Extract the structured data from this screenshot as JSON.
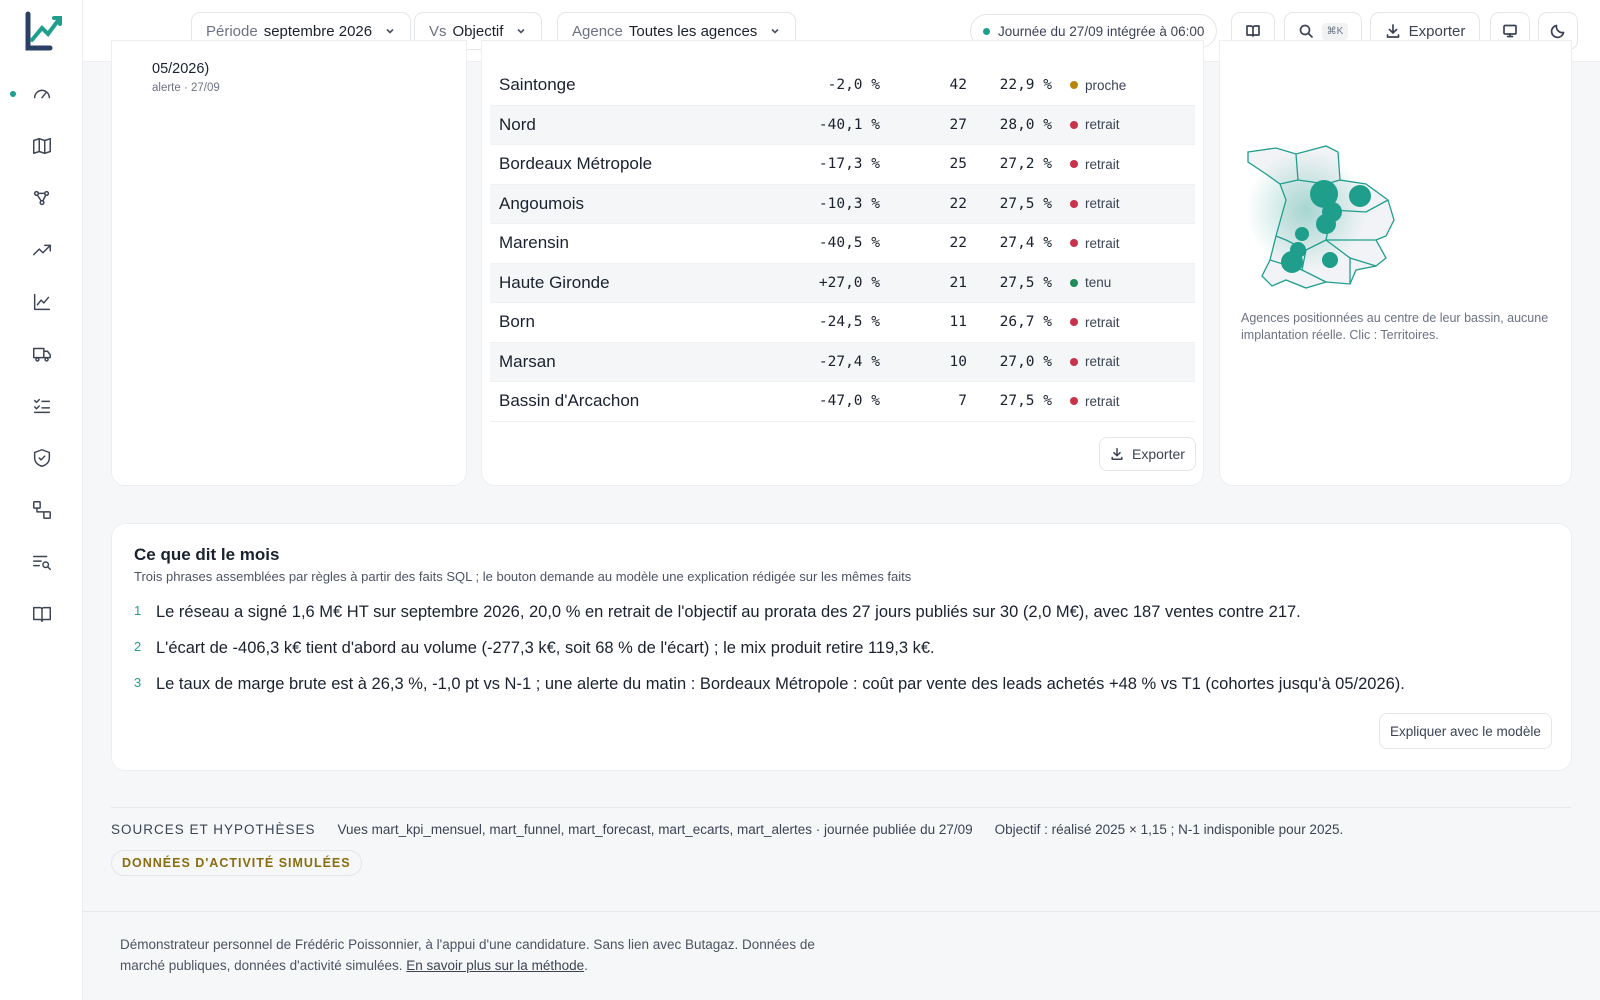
{
  "topbar": {
    "period_label": "Période",
    "period_value": "septembre 2026",
    "vs_label": "Vs",
    "vs_value": "Objectif",
    "agency_label": "Agence",
    "agency_value": "Toutes les agences",
    "status_text": "Journée du 27/09 intégrée à 06:00",
    "search_shortcut": "⌘K",
    "export_label": "Exporter"
  },
  "alert_card": {
    "text_tail": "05/2026)",
    "meta": "alerte · 27/09"
  },
  "agencies_table": {
    "rows": [
      {
        "name": "Saintonge",
        "ecart": "-2,0 %",
        "ventes": "42",
        "marge": "22,9 %",
        "status": "proche",
        "status_color": "#b8860b"
      },
      {
        "name": "Nord",
        "ecart": "-40,1 %",
        "ventes": "27",
        "marge": "28,0 %",
        "status": "retrait",
        "status_color": "#c8324b"
      },
      {
        "name": "Bordeaux Métropole",
        "ecart": "-17,3 %",
        "ventes": "25",
        "marge": "27,2 %",
        "status": "retrait",
        "status_color": "#c8324b"
      },
      {
        "name": "Angoumois",
        "ecart": "-10,3 %",
        "ventes": "22",
        "marge": "27,5 %",
        "status": "retrait",
        "status_color": "#c8324b"
      },
      {
        "name": "Marensin",
        "ecart": "-40,5 %",
        "ventes": "22",
        "marge": "27,4 %",
        "status": "retrait",
        "status_color": "#c8324b"
      },
      {
        "name": "Haute Gironde",
        "ecart": "+27,0 %",
        "ventes": "21",
        "marge": "27,5 %",
        "status": "tenu",
        "status_color": "#1f8a5a"
      },
      {
        "name": "Born",
        "ecart": "-24,5 %",
        "ventes": "11",
        "marge": "26,7 %",
        "status": "retrait",
        "status_color": "#c8324b"
      },
      {
        "name": "Marsan",
        "ecart": "-27,4 %",
        "ventes": "10",
        "marge": "27,0 %",
        "status": "retrait",
        "status_color": "#c8324b"
      },
      {
        "name": "Bassin d'Arcachon",
        "ecart": "-47,0 %",
        "ventes": "7",
        "marge": "27,5 %",
        "status": "retrait",
        "status_color": "#c8324b"
      }
    ],
    "export_label": "Exporter"
  },
  "map_card": {
    "note": "Agences positionnées au centre de leur bassin, aucune implantation réelle. Clic : Territoires.",
    "accent": "#1f9e8c"
  },
  "month_card": {
    "title": "Ce que dit le mois",
    "subtitle": "Trois phrases assemblées par règles à partir des faits SQL ; le bouton demande au modèle une explication rédigée sur les mêmes faits",
    "items": [
      {
        "num": "1",
        "text": "Le réseau a signé 1,6 M€ HT sur septembre 2026, 20,0 % en retrait de l'objectif au prorata des 27 jours publiés sur 30 (2,0 M€), avec 187 ventes contre 217."
      },
      {
        "num": "2",
        "text": "L'écart de -406,3 k€ tient d'abord au volume (-277,3 k€, soit 68 % de l'écart) ; le mix produit retire 119,3 k€."
      },
      {
        "num": "3",
        "text": "Le taux de marge brute est à 26,3 %, -1,0 pt vs N-1 ; une alerte du matin : Bordeaux Métropole : coût par vente des leads achetés +48 % vs T1 (cohortes jusqu'à 05/2026)."
      }
    ],
    "explain_button": "Expliquer avec le modèle"
  },
  "sources": {
    "heading": "SOURCES ET HYPOTHÈSES",
    "views": "Vues mart_kpi_mensuel, mart_funnel, mart_forecast, mart_ecarts, mart_alertes · journée publiée du 27/09",
    "objective": "Objectif : réalisé 2025 × 1,15 ; N-1 indisponible pour 2025.",
    "badge": "DONNÉES D'ACTIVITÉ SIMULÉES"
  },
  "footer": {
    "text": "Démonstrateur personnel de Frédéric Poissonnier, à l'appui d'une candidature. Sans lien avec Butagaz. Données de marché publiques, données d'activité simulées.",
    "link": "En savoir plus sur la méthode",
    "end": "."
  }
}
